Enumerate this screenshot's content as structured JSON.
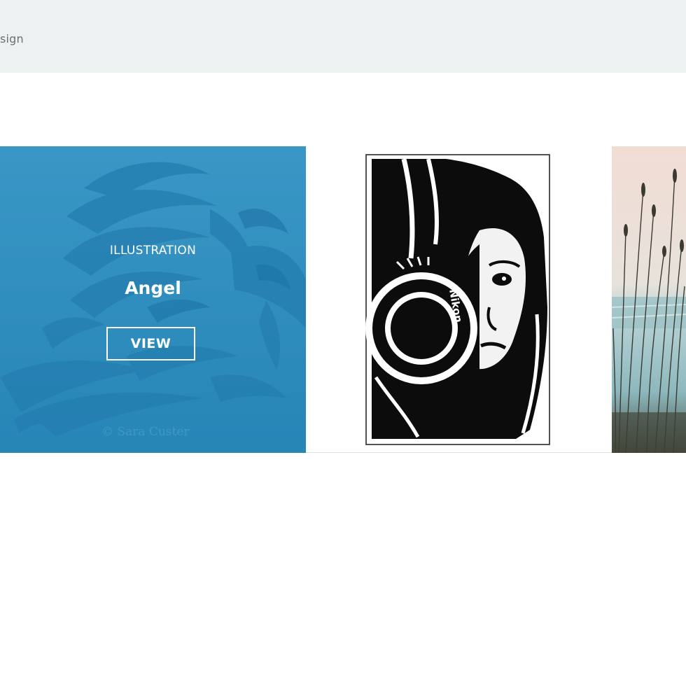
{
  "header": {
    "nav_partial_label": "sign"
  },
  "gallery": {
    "items": [
      {
        "category": "ILLUSTRATION",
        "title": "Angel",
        "button_label": "VIEW",
        "watermark": "© Sara Custer"
      },
      {
        "image_text": "Nikon"
      }
    ]
  },
  "colors": {
    "topbar_bg": "#eef1f2",
    "overlay_blue": "#3a9ac6",
    "text_white": "#ffffff",
    "nav_text": "#6b6f72"
  }
}
